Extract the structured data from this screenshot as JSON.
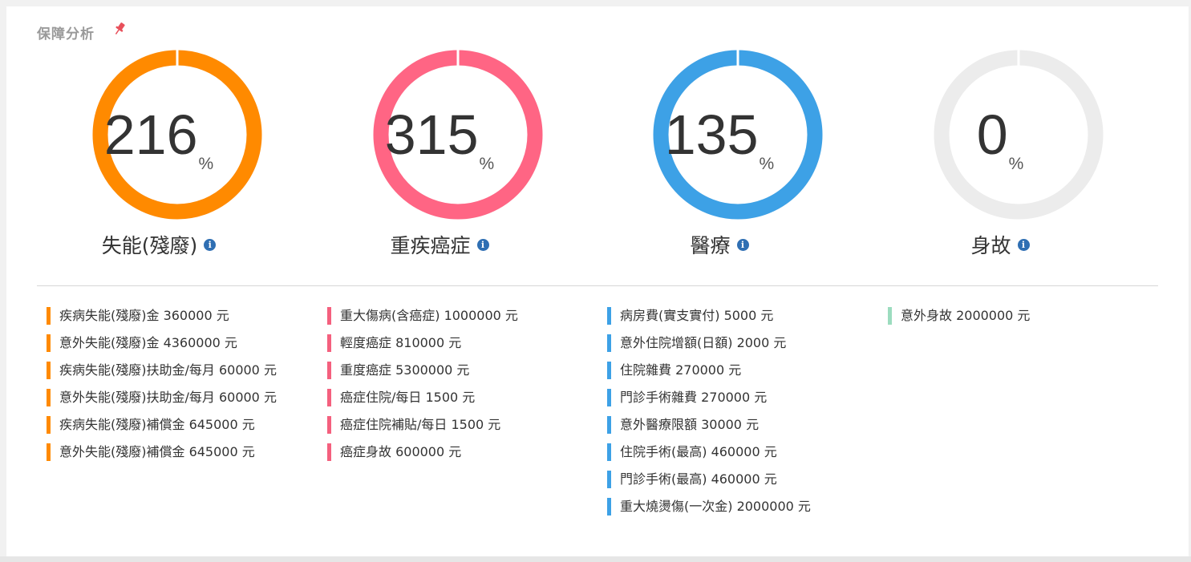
{
  "panel": {
    "title": "保障分析",
    "pin_icon": "pin-icon",
    "pin_color": "#e8505b"
  },
  "gauges": [
    {
      "id": "disability",
      "value": "216",
      "unit": "%",
      "label": "失能(殘廢)",
      "color": "#ff8a00",
      "fill_fraction": 1.0,
      "info_icon": "info-icon"
    },
    {
      "id": "cancer",
      "value": "315",
      "unit": "%",
      "label": "重疾癌症",
      "color": "#ff6584",
      "fill_fraction": 1.0,
      "info_icon": "info-icon"
    },
    {
      "id": "medical",
      "value": "135",
      "unit": "%",
      "label": "醫療",
      "color": "#3da1e6",
      "fill_fraction": 1.0,
      "info_icon": "info-icon"
    },
    {
      "id": "death",
      "value": "0",
      "unit": "%",
      "label": "身故",
      "color": "#ececec",
      "fill_fraction": 0.0,
      "info_icon": "info-icon"
    }
  ],
  "ring_track_color": "#ececec",
  "details": [
    {
      "color": "#ff8a00",
      "items": [
        "疾病失能(殘廢)金 360000 元",
        "意外失能(殘廢)金 4360000 元",
        "疾病失能(殘廢)扶助金/每月 60000 元",
        "意外失能(殘廢)扶助金/每月 60000 元",
        "疾病失能(殘廢)補償金 645000 元",
        "意外失能(殘廢)補償金 645000 元"
      ]
    },
    {
      "color": "#f4607e",
      "items": [
        "重大傷病(含癌症) 1000000 元",
        "輕度癌症 810000 元",
        "重度癌症 5300000 元",
        "癌症住院/每日 1500 元",
        "癌症住院補貼/每日 1500 元",
        "癌症身故 600000 元"
      ]
    },
    {
      "color": "#3da1e6",
      "items": [
        "病房費(實支實付) 5000 元",
        "意外住院增額(日額) 2000 元",
        "住院雜費 270000 元",
        "門診手術雜費 270000 元",
        "意外醫療限額 30000 元",
        "住院手術(最高) 460000 元",
        "門診手術(最高) 460000 元",
        "重大燒燙傷(一次金) 2000000 元"
      ]
    },
    {
      "color": "#9cdcbf",
      "items": [
        "意外身故 2000000 元"
      ]
    }
  ]
}
